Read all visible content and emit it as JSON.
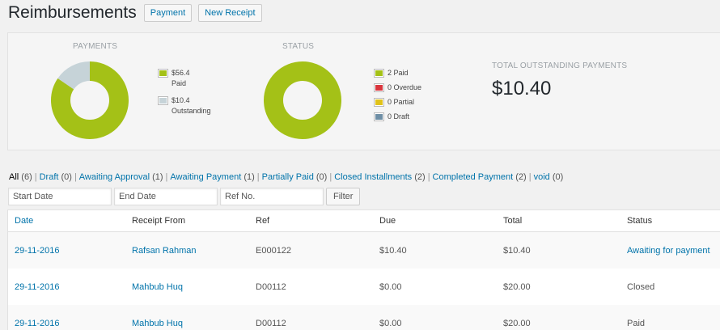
{
  "header": {
    "title": "Reimbursements",
    "payment_button": "Payment",
    "new_receipt_button": "New Receipt"
  },
  "payments_chart": {
    "title": "PAYMENTS",
    "legend": [
      {
        "amount": "$56.4",
        "label": "Paid",
        "color": "#a4c117",
        "value": 56.4
      },
      {
        "amount": "$10.4",
        "label": "Outstanding",
        "color": "#c6d3d8",
        "value": 10.4
      }
    ]
  },
  "status_chart": {
    "title": "STATUS",
    "legend": [
      {
        "label": "2 Paid",
        "color": "#a4c117",
        "value": 2
      },
      {
        "label": "0 Overdue",
        "color": "#d9363e",
        "value": 0
      },
      {
        "label": "0 Partial",
        "color": "#e0c21a",
        "value": 0
      },
      {
        "label": "0 Draft",
        "color": "#6e8ea5",
        "value": 0
      }
    ]
  },
  "total": {
    "label": "TOTAL OUTSTANDING PAYMENTS",
    "value": "$10.40"
  },
  "filters": [
    {
      "label": "All",
      "count": "(6)",
      "current": true
    },
    {
      "label": "Draft",
      "count": "(0)"
    },
    {
      "label": "Awaiting Approval",
      "count": "(1)"
    },
    {
      "label": "Awaiting Payment",
      "count": "(1)"
    },
    {
      "label": "Partially Paid",
      "count": "(0)"
    },
    {
      "label": "Closed Installments",
      "count": "(2)"
    },
    {
      "label": "Completed Payment",
      "count": "(2)"
    },
    {
      "label": "void",
      "count": "(0)"
    }
  ],
  "filter_row": {
    "start_date_placeholder": "Start Date",
    "end_date_placeholder": "End Date",
    "ref_placeholder": "Ref No.",
    "filter_button": "Filter"
  },
  "table": {
    "columns": [
      "Date",
      "Receipt From",
      "Ref",
      "Due",
      "Total",
      "Status"
    ],
    "rows": [
      {
        "date": "29-11-2016",
        "from": "Rafsan Rahman",
        "ref": "E000122",
        "due": "$10.40",
        "total": "$10.40",
        "status": "Awaiting for payment",
        "status_link": true
      },
      {
        "date": "29-11-2016",
        "from": "Mahbub Huq",
        "ref": "D00112",
        "due": "$0.00",
        "total": "$20.00",
        "status": "Closed",
        "status_link": false
      },
      {
        "date": "29-11-2016",
        "from": "Mahbub Huq",
        "ref": "D00112",
        "due": "$0.00",
        "total": "$20.00",
        "status": "Paid",
        "status_link": false
      }
    ]
  }
}
